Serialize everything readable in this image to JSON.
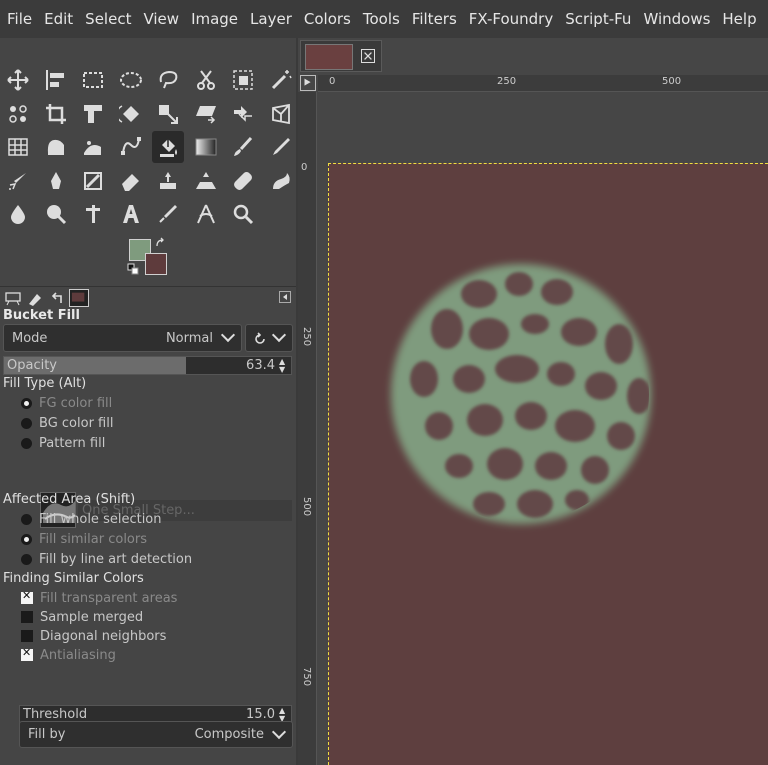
{
  "menu": [
    "File",
    "Edit",
    "Select",
    "View",
    "Image",
    "Layer",
    "Colors",
    "Tools",
    "Filters",
    "FX-Foundry",
    "Script-Fu",
    "Windows",
    "Help"
  ],
  "tool_options": {
    "title": "Bucket Fill",
    "mode_label": "Mode",
    "mode_value": "Normal",
    "opacity_label": "Opacity",
    "opacity_value": "63.4",
    "opacity_fraction": 0.634,
    "fill_type_label": "Fill Type  (Alt)",
    "fill_type_options": [
      {
        "label": "FG color fill",
        "selected": true
      },
      {
        "label": "BG color fill",
        "selected": false
      },
      {
        "label": "Pattern fill",
        "selected": false
      }
    ],
    "pattern_name": "One Small Step...",
    "affected_area_label": "Affected Area  (Shift)",
    "affected_area_options": [
      {
        "label": "Fill whole selection",
        "selected": false
      },
      {
        "label": "Fill similar colors",
        "selected": true
      },
      {
        "label": "Fill by line art detection",
        "selected": false
      }
    ],
    "finding_label": "Finding Similar Colors",
    "finding_options": [
      {
        "label": "Fill transparent areas",
        "checked": true
      },
      {
        "label": "Sample merged",
        "checked": false
      },
      {
        "label": "Diagonal neighbors",
        "checked": false
      },
      {
        "label": "Antialiasing",
        "checked": true
      }
    ],
    "threshold_label": "Threshold",
    "threshold_value": "15.0",
    "fill_by_label": "Fill by",
    "fill_by_value": "Composite"
  },
  "colors": {
    "fg": "#7f9b7e",
    "bg": "#5e3b3c"
  },
  "rulers": {
    "top": [
      "0",
      "250",
      "500"
    ],
    "left": [
      "0",
      "250",
      "500",
      "750"
    ]
  },
  "tools": [
    "move-icon",
    "align-icon",
    "rect-select-icon",
    "ellipse-select-icon",
    "free-select-icon",
    "scissors-icon",
    "foreground-select-icon",
    "fuzzy-select-icon",
    "by-color-select-icon",
    "crop-icon",
    "unified-transform-icon",
    "rotate-icon",
    "scale-icon",
    "shear-icon",
    "flip-icon",
    "perspective-icon",
    "cage-icon",
    "warp-icon",
    "handle-transform-icon",
    "path-icon",
    "bucket-fill-icon",
    "gradient-icon",
    "paintbrush-icon",
    "pencil-icon",
    "airbrush-icon",
    "ink-icon",
    "mypaint-icon",
    "eraser-icon",
    "clone-icon",
    "perspective-clone-icon",
    "heal-icon",
    "smudge-icon",
    "blur-icon",
    "dodge-burn-icon",
    "text-tool-icon",
    "text-icon",
    "color-picker-icon",
    "measure-icon",
    "zoom-icon"
  ]
}
